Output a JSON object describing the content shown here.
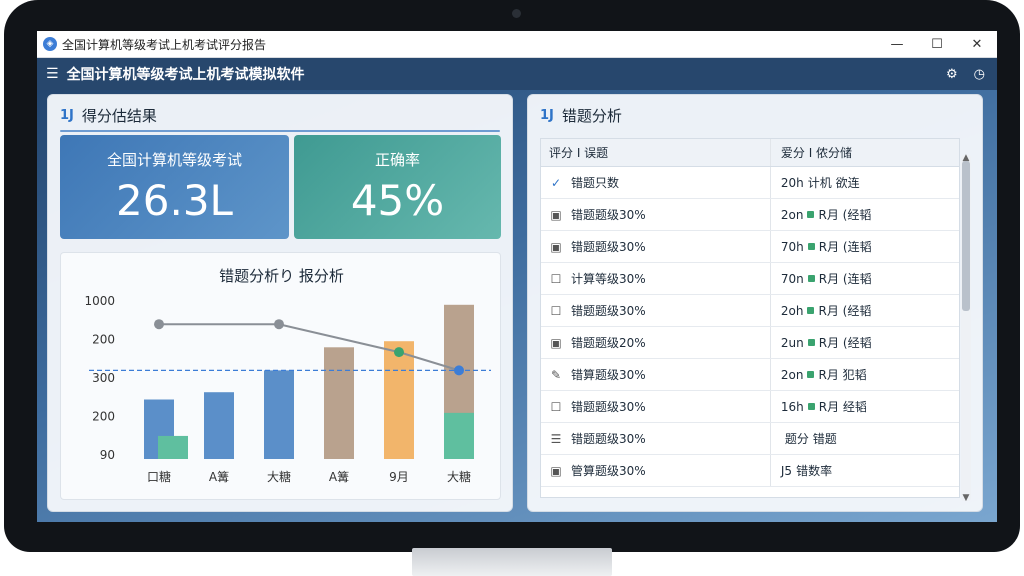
{
  "window": {
    "title": "全国计算机等级考试上机考试评分报告",
    "minimize": "—",
    "maximize": "☐",
    "close": "✕"
  },
  "app": {
    "title": "全国计算机等级考试上机考试模拟软件",
    "menu_icon": "menu-icon",
    "settings_icon": "gear-icon",
    "info_icon": "clock-icon"
  },
  "left_panel": {
    "title": "得分估结果",
    "icon": "1J",
    "card1": {
      "label": "全国计算机等级考试",
      "value": "26.3L"
    },
    "card2": {
      "label": "正确率",
      "value": "45%"
    }
  },
  "chart_data": {
    "type": "bar",
    "title": "错题分析り 报分析",
    "categories": [
      "口糖",
      "A篝",
      "大糖",
      "A篝",
      "9月",
      "大糖"
    ],
    "y_ticks": [
      "1000",
      "200",
      "300",
      "200",
      "90"
    ],
    "series": [
      {
        "values": [
          0.49,
          0.55,
          0.73,
          0.92,
          0.97,
          1.27
        ],
        "colors": [
          "#5b8fc9",
          "#5b8fc9",
          "#5b8fc9",
          "#b9a28e",
          "#f2b56b",
          "#b9a28e"
        ]
      },
      {
        "values": [
          0.19,
          null,
          null,
          null,
          null,
          0.38
        ],
        "colors": [
          "#5fbf9f",
          null,
          null,
          null,
          null,
          "#5fbf9f"
        ]
      }
    ],
    "line": [
      1.11,
      null,
      1.11,
      null,
      0.88,
      0.73
    ],
    "reference_line": 0.73,
    "ylim": [
      0,
      1.4
    ]
  },
  "right_panel": {
    "title": "错题分析",
    "icon": "1J",
    "table": {
      "headers": [
        "评分 I 误题",
        "爱分 I 侬分储"
      ],
      "rows": [
        {
          "icon": "check-icon",
          "glyph": "✓",
          "name": "错题只数",
          "time": "20h",
          "status": "计机 欲连"
        },
        {
          "icon": "doc-icon",
          "glyph": "▣",
          "name": "错题题级30%",
          "time": "2on",
          "status": "R月 (经韬"
        },
        {
          "icon": "doc-icon",
          "glyph": "▣",
          "name": "错题题级30%",
          "time": "70h",
          "status": "R月 (连韬"
        },
        {
          "icon": "box-icon",
          "glyph": "☐",
          "name": "计算等级30%",
          "time": "70n",
          "status": "R月 (连韬"
        },
        {
          "icon": "box-icon",
          "glyph": "☐",
          "name": "错题题级30%",
          "time": "2oh",
          "status": "R月 (经韬"
        },
        {
          "icon": "doc-icon",
          "glyph": "▣",
          "name": "错题题级20%",
          "time": "2un",
          "status": "R月 (经韬"
        },
        {
          "icon": "edit-icon",
          "glyph": "✎",
          "name": "错算题级30%",
          "time": "2on",
          "status": "R月 犯韬"
        },
        {
          "icon": "box-icon",
          "glyph": "☐",
          "name": "错题题级30%",
          "time": "16h",
          "status": "R月 经韬"
        },
        {
          "icon": "list-icon",
          "glyph": "☰",
          "name": "错题题级30%",
          "time": "",
          "status": "题分 错题"
        },
        {
          "icon": "doc-icon",
          "glyph": "▣",
          "name": "管算题级30%",
          "time": "J5 ",
          "status": "错数率"
        }
      ]
    }
  }
}
